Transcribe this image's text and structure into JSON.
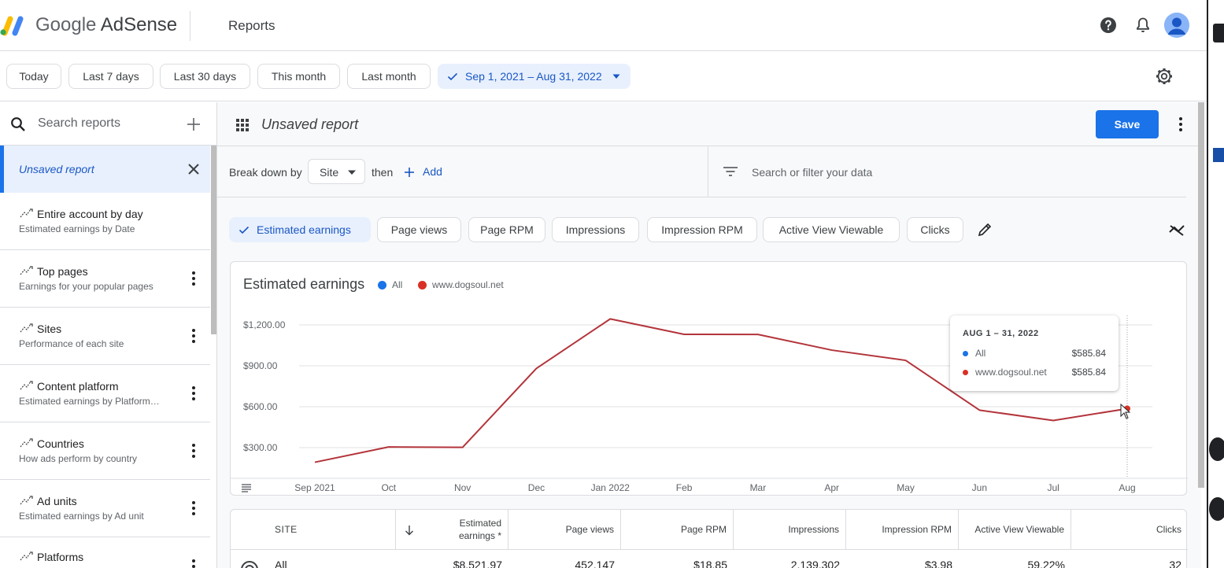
{
  "header": {
    "brand_google": "Google",
    "brand_product": "AdSense",
    "page_title": "Reports",
    "colors": {
      "blue": "#4285f4",
      "yellow": "#fbbc04",
      "green": "#34a853"
    }
  },
  "date_bar": {
    "presets": [
      "Today",
      "Last 7 days",
      "Last 30 days",
      "This month",
      "Last month"
    ],
    "selected_range": "Sep 1, 2021 – Aug 31, 2022"
  },
  "sidebar": {
    "search_placeholder": "Search reports",
    "active_report": "Unsaved report",
    "items": [
      {
        "title": "Entire account by day",
        "subtitle": "Estimated earnings by Date"
      },
      {
        "title": "Top pages",
        "subtitle": "Earnings for your popular pages"
      },
      {
        "title": "Sites",
        "subtitle": "Performance of each site"
      },
      {
        "title": "Content platform",
        "subtitle": "Estimated earnings by Platform…"
      },
      {
        "title": "Countries",
        "subtitle": "How ads perform by country"
      },
      {
        "title": "Ad units",
        "subtitle": "Estimated earnings by Ad unit"
      },
      {
        "title": "Platforms",
        "subtitle": ""
      }
    ]
  },
  "report_bar": {
    "title": "Unsaved report",
    "save_label": "Save"
  },
  "filter_bar": {
    "breakdown_label": "Break down by",
    "breakdown_value": "Site",
    "then_label": "then",
    "add_label": "Add",
    "search_placeholder": "Search or filter your data"
  },
  "metrics": [
    "Estimated earnings",
    "Page views",
    "Page RPM",
    "Impressions",
    "Impression RPM",
    "Active View Viewable",
    "Clicks"
  ],
  "chart": {
    "title": "Estimated earnings",
    "legend": [
      {
        "name": "All",
        "color": "#1a73e8"
      },
      {
        "name": "www.dogsoul.net",
        "color": "#d93025"
      }
    ],
    "tooltip": {
      "title": "AUG 1 – 31, 2022",
      "rows": [
        {
          "name": "All",
          "value": "$585.84",
          "color": "#1a73e8"
        },
        {
          "name": "www.dogsoul.net",
          "value": "$585.84",
          "color": "#d93025"
        }
      ]
    }
  },
  "chart_data": {
    "type": "line",
    "x": [
      "Sep 2021",
      "Oct",
      "Nov",
      "Dec",
      "Jan 2022",
      "Feb",
      "Mar",
      "Apr",
      "May",
      "Jun",
      "Jul",
      "Aug"
    ],
    "yticks": [
      "$300.00",
      "$600.00",
      "$900.00",
      "$1,200.00"
    ],
    "ylim": [
      0,
      1300
    ],
    "grid": true,
    "series": [
      {
        "name": "www.dogsoul.net",
        "color": "#b3343b",
        "values": [
          193,
          305,
          302,
          881,
          1244,
          1131,
          1130,
          1015,
          940,
          575,
          499,
          585.84
        ]
      }
    ]
  },
  "table": {
    "headers": [
      "SITE",
      "Estimated earnings *",
      "Page views",
      "Page RPM",
      "Impressions",
      "Impression RPM",
      "Active View Viewable",
      "Clicks"
    ],
    "row": [
      "All",
      "$8,521.97",
      "452,147",
      "$18.85",
      "2,139,302",
      "$3.98",
      "59.22%",
      "32"
    ]
  }
}
